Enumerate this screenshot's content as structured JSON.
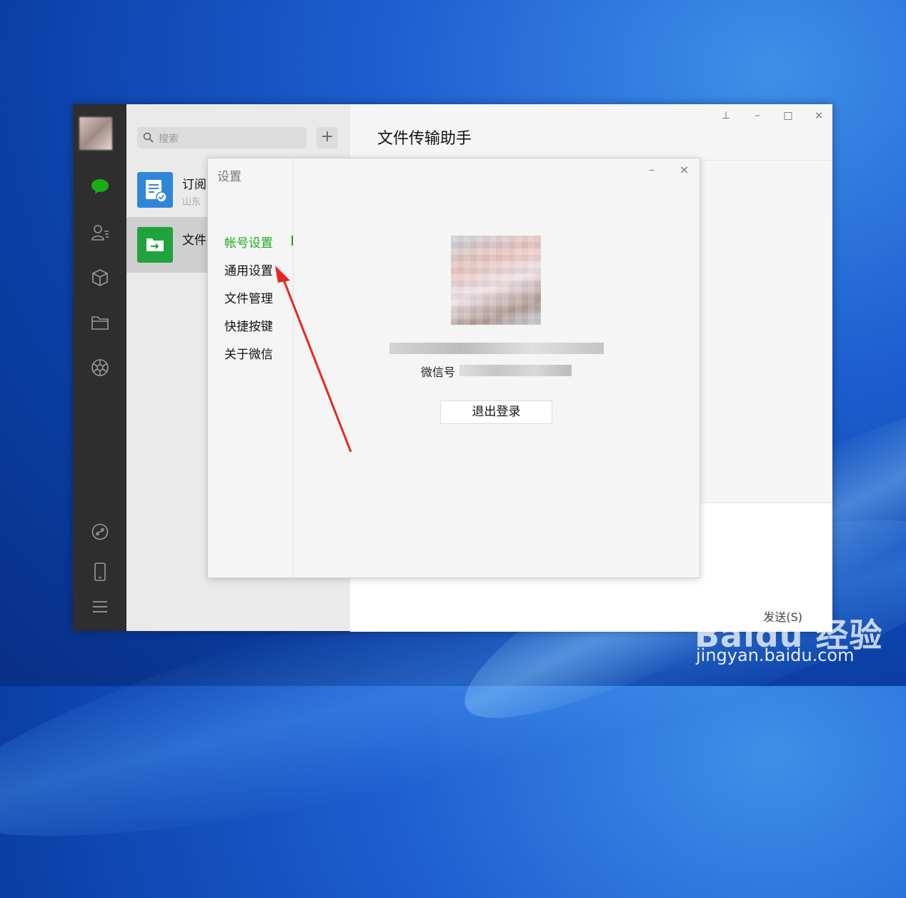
{
  "main_window": {
    "search": {
      "placeholder": "搜索"
    },
    "add_label": "+",
    "chats": [
      {
        "name": "订阅",
        "preview": "山东"
      },
      {
        "name": "文件"
      }
    ],
    "main_title": "文件传输助手",
    "send_label": "发送(S)",
    "controls": {
      "pin": "⊥",
      "minimize": "–",
      "maximize": "□",
      "close": "×"
    }
  },
  "settings_dialog": {
    "title": "设置",
    "minimize": "–",
    "close": "×",
    "nav": [
      {
        "label": "帐号设置",
        "active": true
      },
      {
        "label": "通用设置",
        "active": false
      },
      {
        "label": "文件管理",
        "active": false
      },
      {
        "label": "快捷按键",
        "active": false
      },
      {
        "label": "关于微信",
        "active": false
      }
    ],
    "wechat_id_label": "微信号",
    "logout_label": "退出登录"
  },
  "watermark": {
    "logo": "Baidu 经验",
    "url": "jingyan.baidu.com"
  },
  "colors": {
    "accent": "#1aad19",
    "sidebar": "#2e2e2e",
    "arrow": "#e8251f"
  }
}
